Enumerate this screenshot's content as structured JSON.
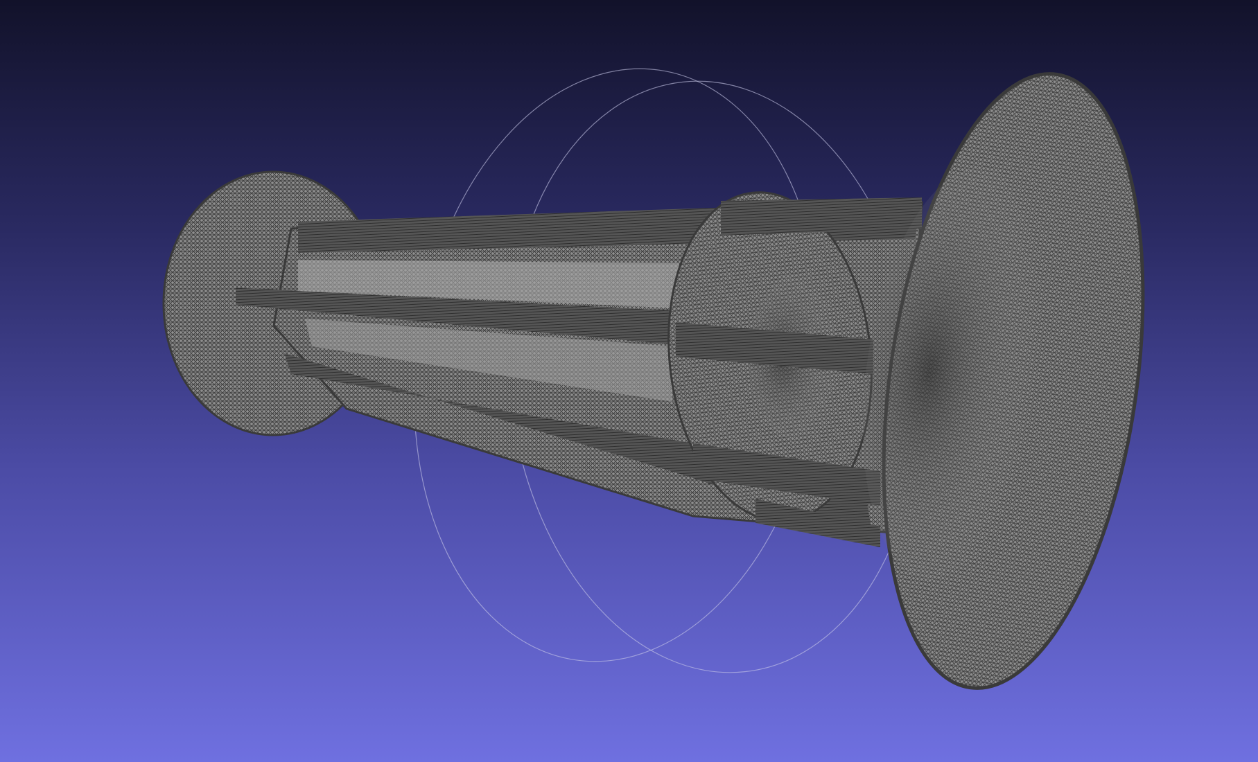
{
  "viewport": {
    "background_top": "#12122a",
    "background_bottom": "#6f70e0",
    "mesh_fill": "#8c8c8c",
    "wire_color": "#3a3a3a",
    "trackball_color": "#c8c8e8"
  }
}
